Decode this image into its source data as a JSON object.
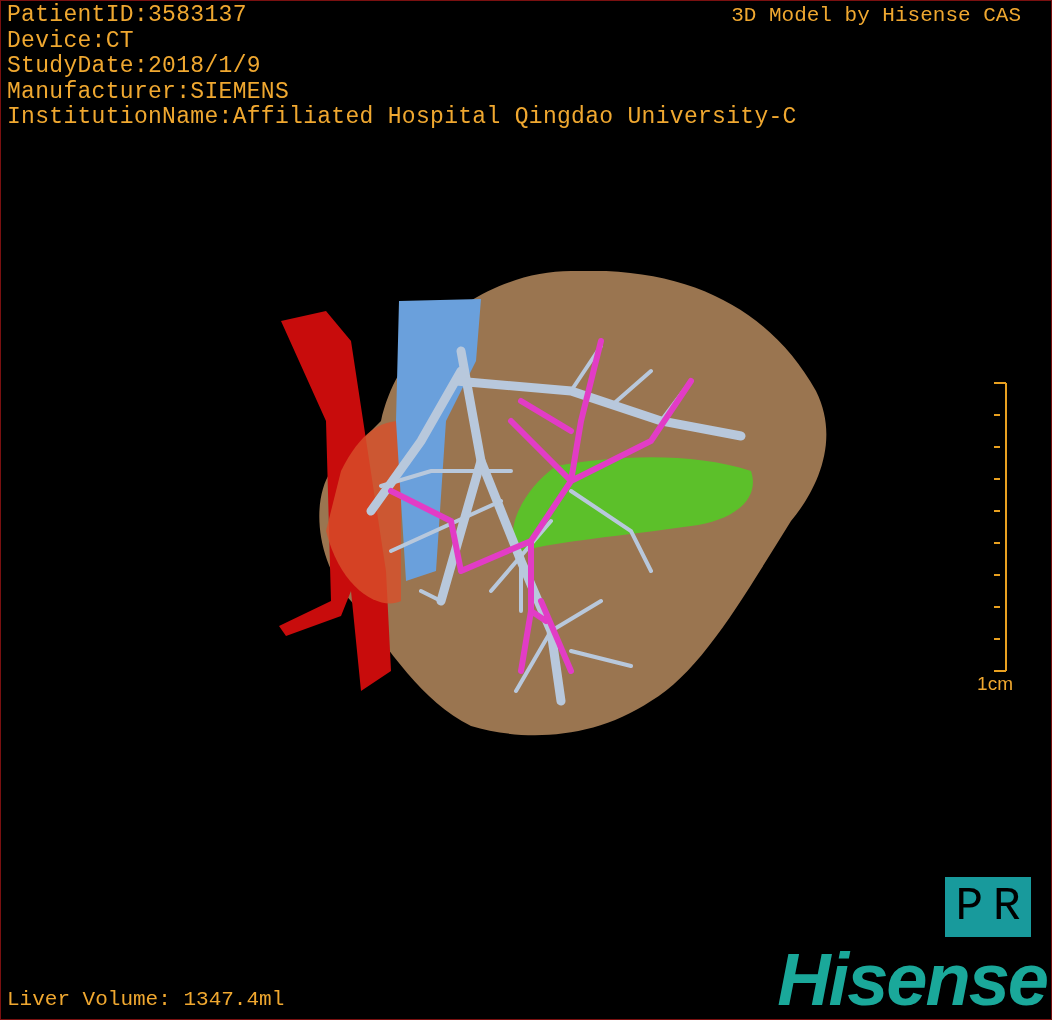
{
  "study_info": [
    "PatientID:3583137",
    "Device:CT",
    "StudyDate:2018/1/9",
    "Manufacturer:SIEMENS",
    "InstitutionName:Affiliated Hospital Qingdao University-C"
  ],
  "title": "3D Model by Hisense CAS",
  "scale_bar": {
    "label": "1cm"
  },
  "orientation": [
    "P",
    "R"
  ],
  "measurement": "Liver Volume: 1347.4ml",
  "logo": "Hisense"
}
